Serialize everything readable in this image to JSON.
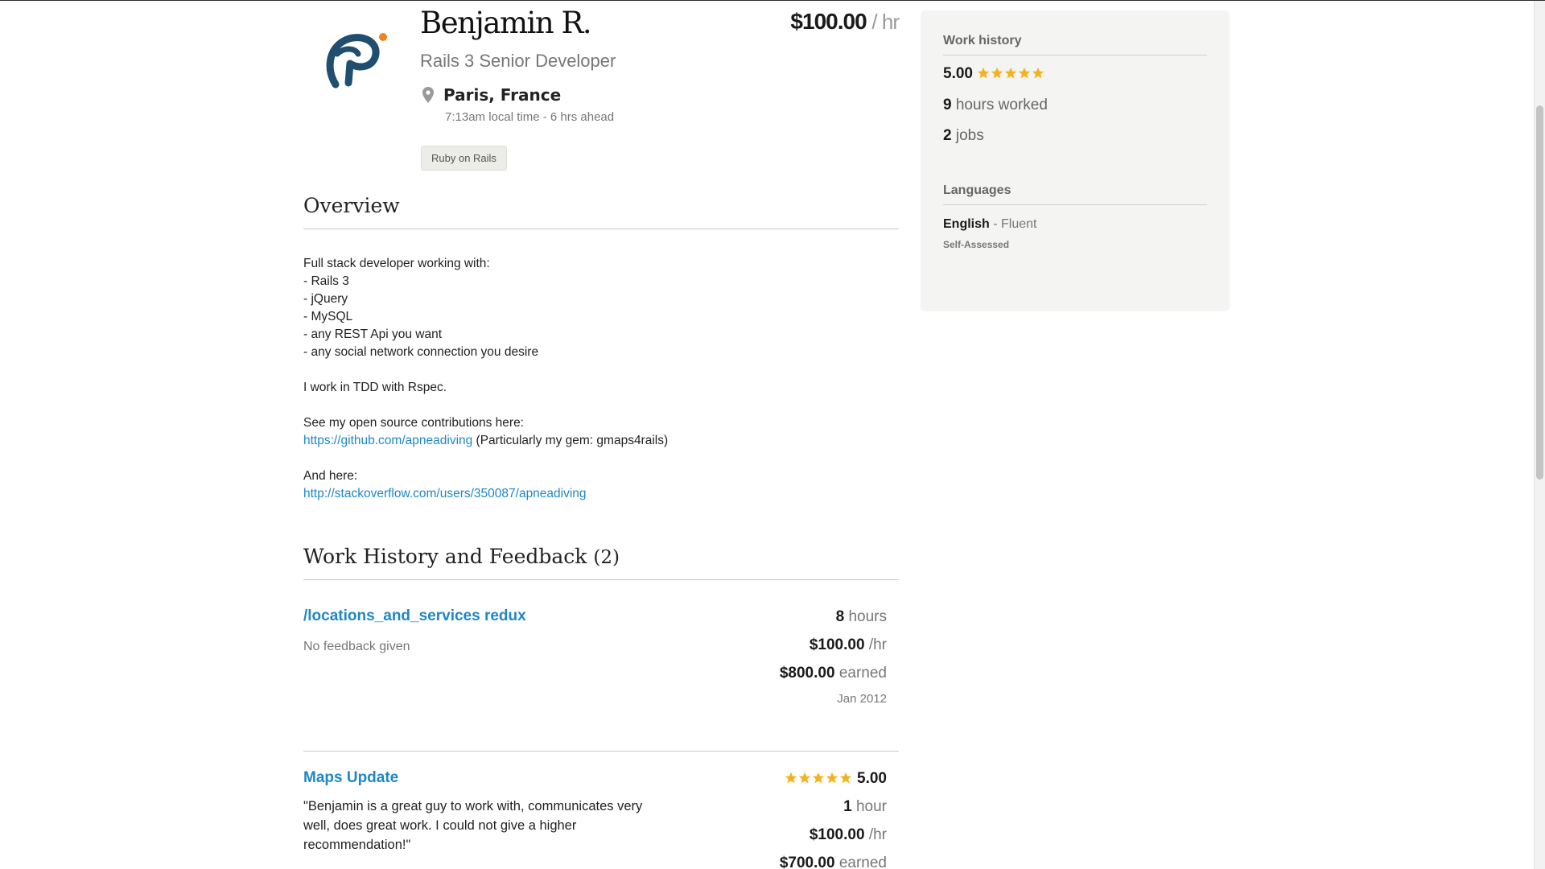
{
  "profile": {
    "name": "Benjamin R.",
    "rate_amount": "$100.00",
    "rate_unit": "/ hr",
    "title": "Rails 3 Senior Developer",
    "location": "Paris, France",
    "local_time": "7:13am local time - 6 hrs ahead",
    "skills": [
      "Ruby on Rails"
    ]
  },
  "overview": {
    "heading": "Overview",
    "lines": [
      "Full stack developer working with:",
      "- Rails 3",
      "- jQuery",
      "- MySQL",
      "- any REST Api you want",
      "- any social network connection you desire"
    ],
    "tdd": "I work in TDD with Rspec.",
    "oss_intro": "See my open source contributions here:",
    "github_link": "https://github.com/apneadiving",
    "github_note": " (Particularly my gem: gmaps4rails)",
    "and_here": "And here:",
    "so_link": "http://stackoverflow.com/users/350087/apneadiving"
  },
  "work_history": {
    "heading": "Work History and Feedback",
    "count": "(2)",
    "jobs": [
      {
        "title": "/locations_and_services redux",
        "feedback": "No feedback given",
        "hours_value": "8",
        "hours_label": " hours",
        "rate_value": "$100.00",
        "rate_label": " /hr",
        "earned_value": "$800.00",
        "earned_label": " earned",
        "date": "Jan 2012"
      },
      {
        "title": "Maps Update",
        "rating": 5.0,
        "rating_text": "5.00",
        "feedback": "\"Benjamin is a great guy to work with, communicates very well, does great work.  I could not give a higher recommendation!\"",
        "hours_value": "1",
        "hours_label": " hour",
        "rate_value": "$100.00",
        "rate_label": " /hr",
        "earned_value": "$700.00",
        "earned_label": " earned"
      }
    ]
  },
  "sidebar": {
    "work_history_heading": "Work history",
    "rating": 5.0,
    "rating_text": "5.00",
    "hours_value": "9",
    "hours_label": " hours worked",
    "jobs_value": "2",
    "jobs_label": " jobs",
    "languages_heading": "Languages",
    "language_name": "English",
    "language_level": " - Fluent",
    "language_note": "Self-Assessed"
  },
  "colors": {
    "link": "#1e87c8",
    "star": "#f5b21e",
    "logo_primary": "#1f4e6e",
    "logo_accent": "#f0821e"
  },
  "icons": {
    "location": "map-pin-icon",
    "star": "star-icon",
    "logo": "profile-logo"
  }
}
